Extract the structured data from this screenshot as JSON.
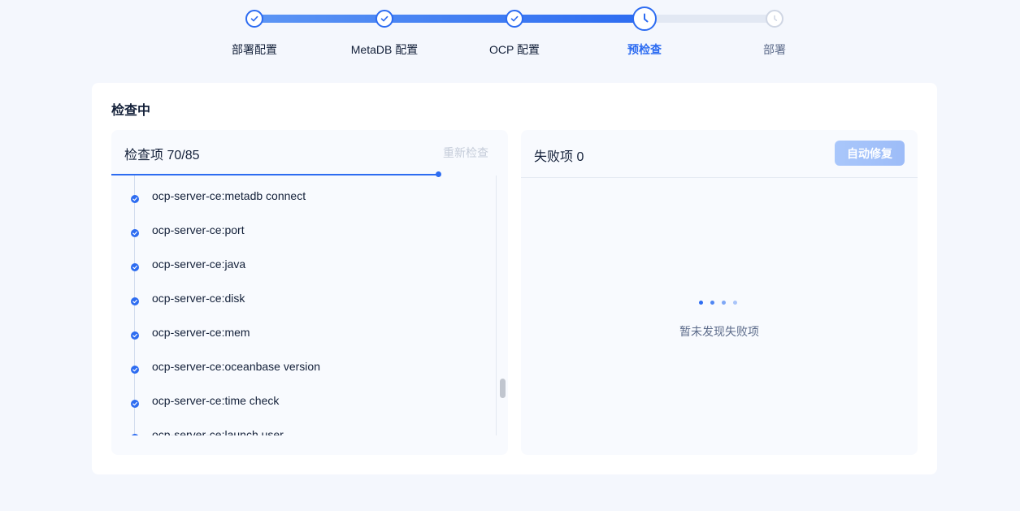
{
  "steps": [
    {
      "label": "部署配置",
      "status": "done"
    },
    {
      "label": "MetaDB 配置",
      "status": "done"
    },
    {
      "label": "OCP 配置",
      "status": "done"
    },
    {
      "label": "预检查",
      "status": "active"
    },
    {
      "label": "部署",
      "status": "todo"
    }
  ],
  "card": {
    "title": "检查中"
  },
  "check_panel": {
    "title": "检查项 70/85",
    "progress": {
      "done": 70,
      "total": 85
    },
    "recheck_label": "重新检查",
    "items": [
      "ocp-server-ce:metadb connect",
      "ocp-server-ce:port",
      "ocp-server-ce:java",
      "ocp-server-ce:disk",
      "ocp-server-ce:mem",
      "ocp-server-ce:oceanbase version",
      "ocp-server-ce:time check",
      "ocp-server-ce:launch user"
    ]
  },
  "fail_panel": {
    "title": "失败项 0",
    "auto_fix_label": "自动修复",
    "empty_text": "暂未发现失败项"
  },
  "colors": {
    "accent": "#2d6cf1",
    "muted": "#5c6b8a"
  }
}
